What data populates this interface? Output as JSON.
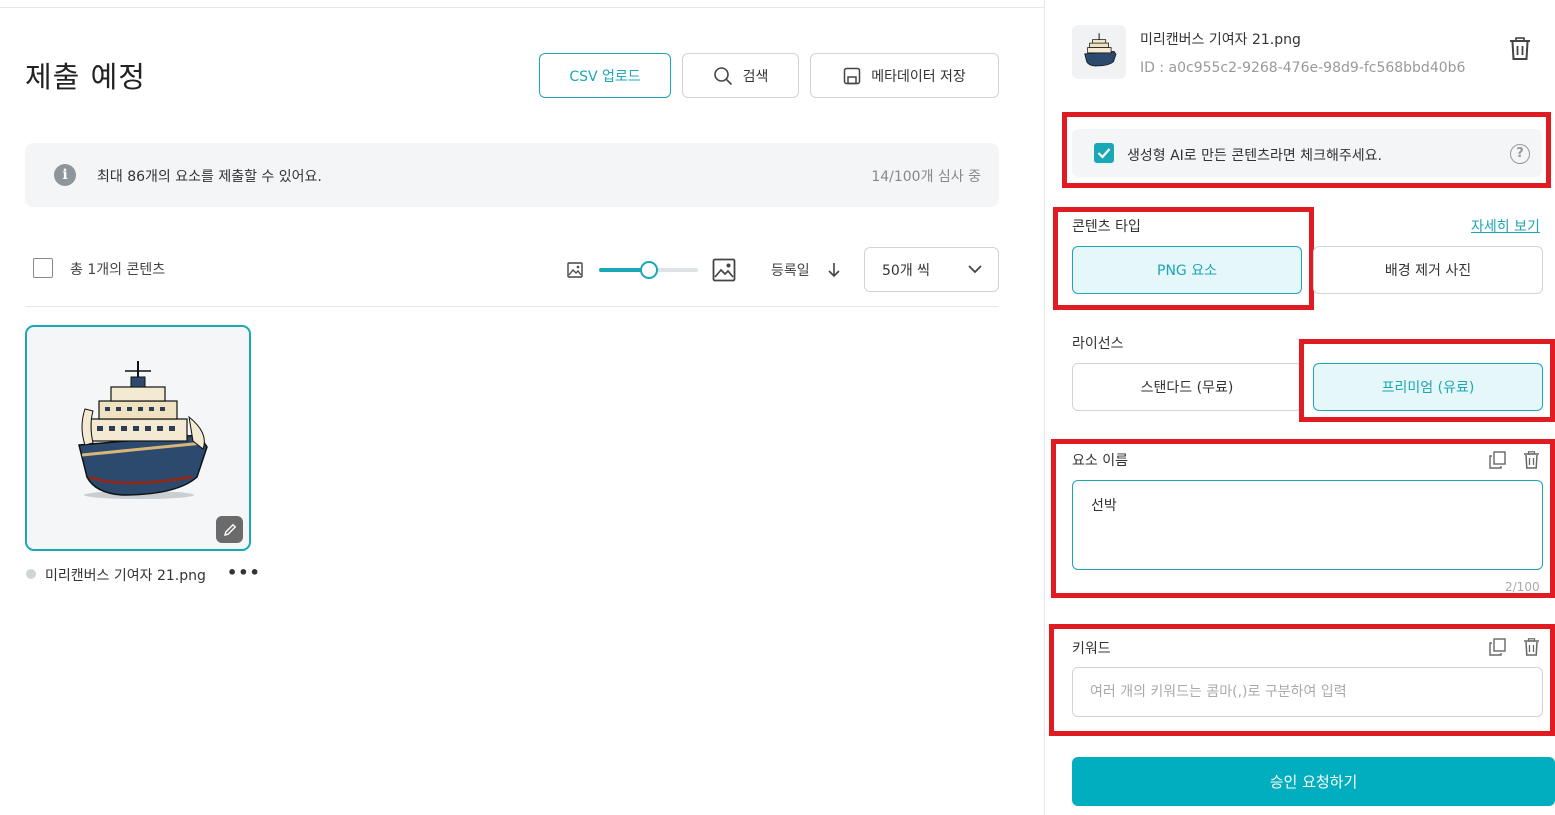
{
  "left": {
    "page_title": "제출 예정",
    "toolbar": {
      "csv_upload": "CSV 업로드",
      "search": "검색",
      "save_metadata": "메타데이터 저장"
    },
    "info": {
      "message": "최대 86개의 요소를 제출할 수 있어요.",
      "review_status": "14/100개 심사 중"
    },
    "list_controls": {
      "total_label": "총 1개의 콘텐츠",
      "thumb_size_level": 0.5,
      "sort_label": "등록일",
      "page_size": "50개 씩"
    },
    "items": [
      {
        "file_name": "미리캔버스 기여자 21.png",
        "more": "•••"
      }
    ]
  },
  "right": {
    "file_name": "미리캔버스 기여자 21.png",
    "file_id": "ID : a0c955c2-9268-476e-98d9-fc568bbd40b6",
    "ai_generated_label": "생성형 AI로 만든 콘텐츠라면 체크해주세요.",
    "ai_generated_checked": true,
    "content_type": {
      "label": "콘텐츠 타입",
      "detail_link": "자세히 보기",
      "options": [
        "PNG 요소",
        "배경 제거 사진"
      ],
      "selected": "PNG 요소"
    },
    "license": {
      "label": "라이선스",
      "options": [
        "스탠다드 (무료)",
        "프리미엄 (유료)"
      ],
      "selected": "프리미엄 (유료)"
    },
    "element_name": {
      "label": "요소 이름",
      "value": "선박",
      "count": "2/100"
    },
    "keywords": {
      "label": "키워드",
      "placeholder": "여러 개의 키워드는 콤마(,)로 구분하여 입력"
    },
    "submit": "승인 요청하기"
  },
  "colors": {
    "accent": "#1aa7b6",
    "submit": "#00aec0",
    "highlight": "#e11b22"
  }
}
